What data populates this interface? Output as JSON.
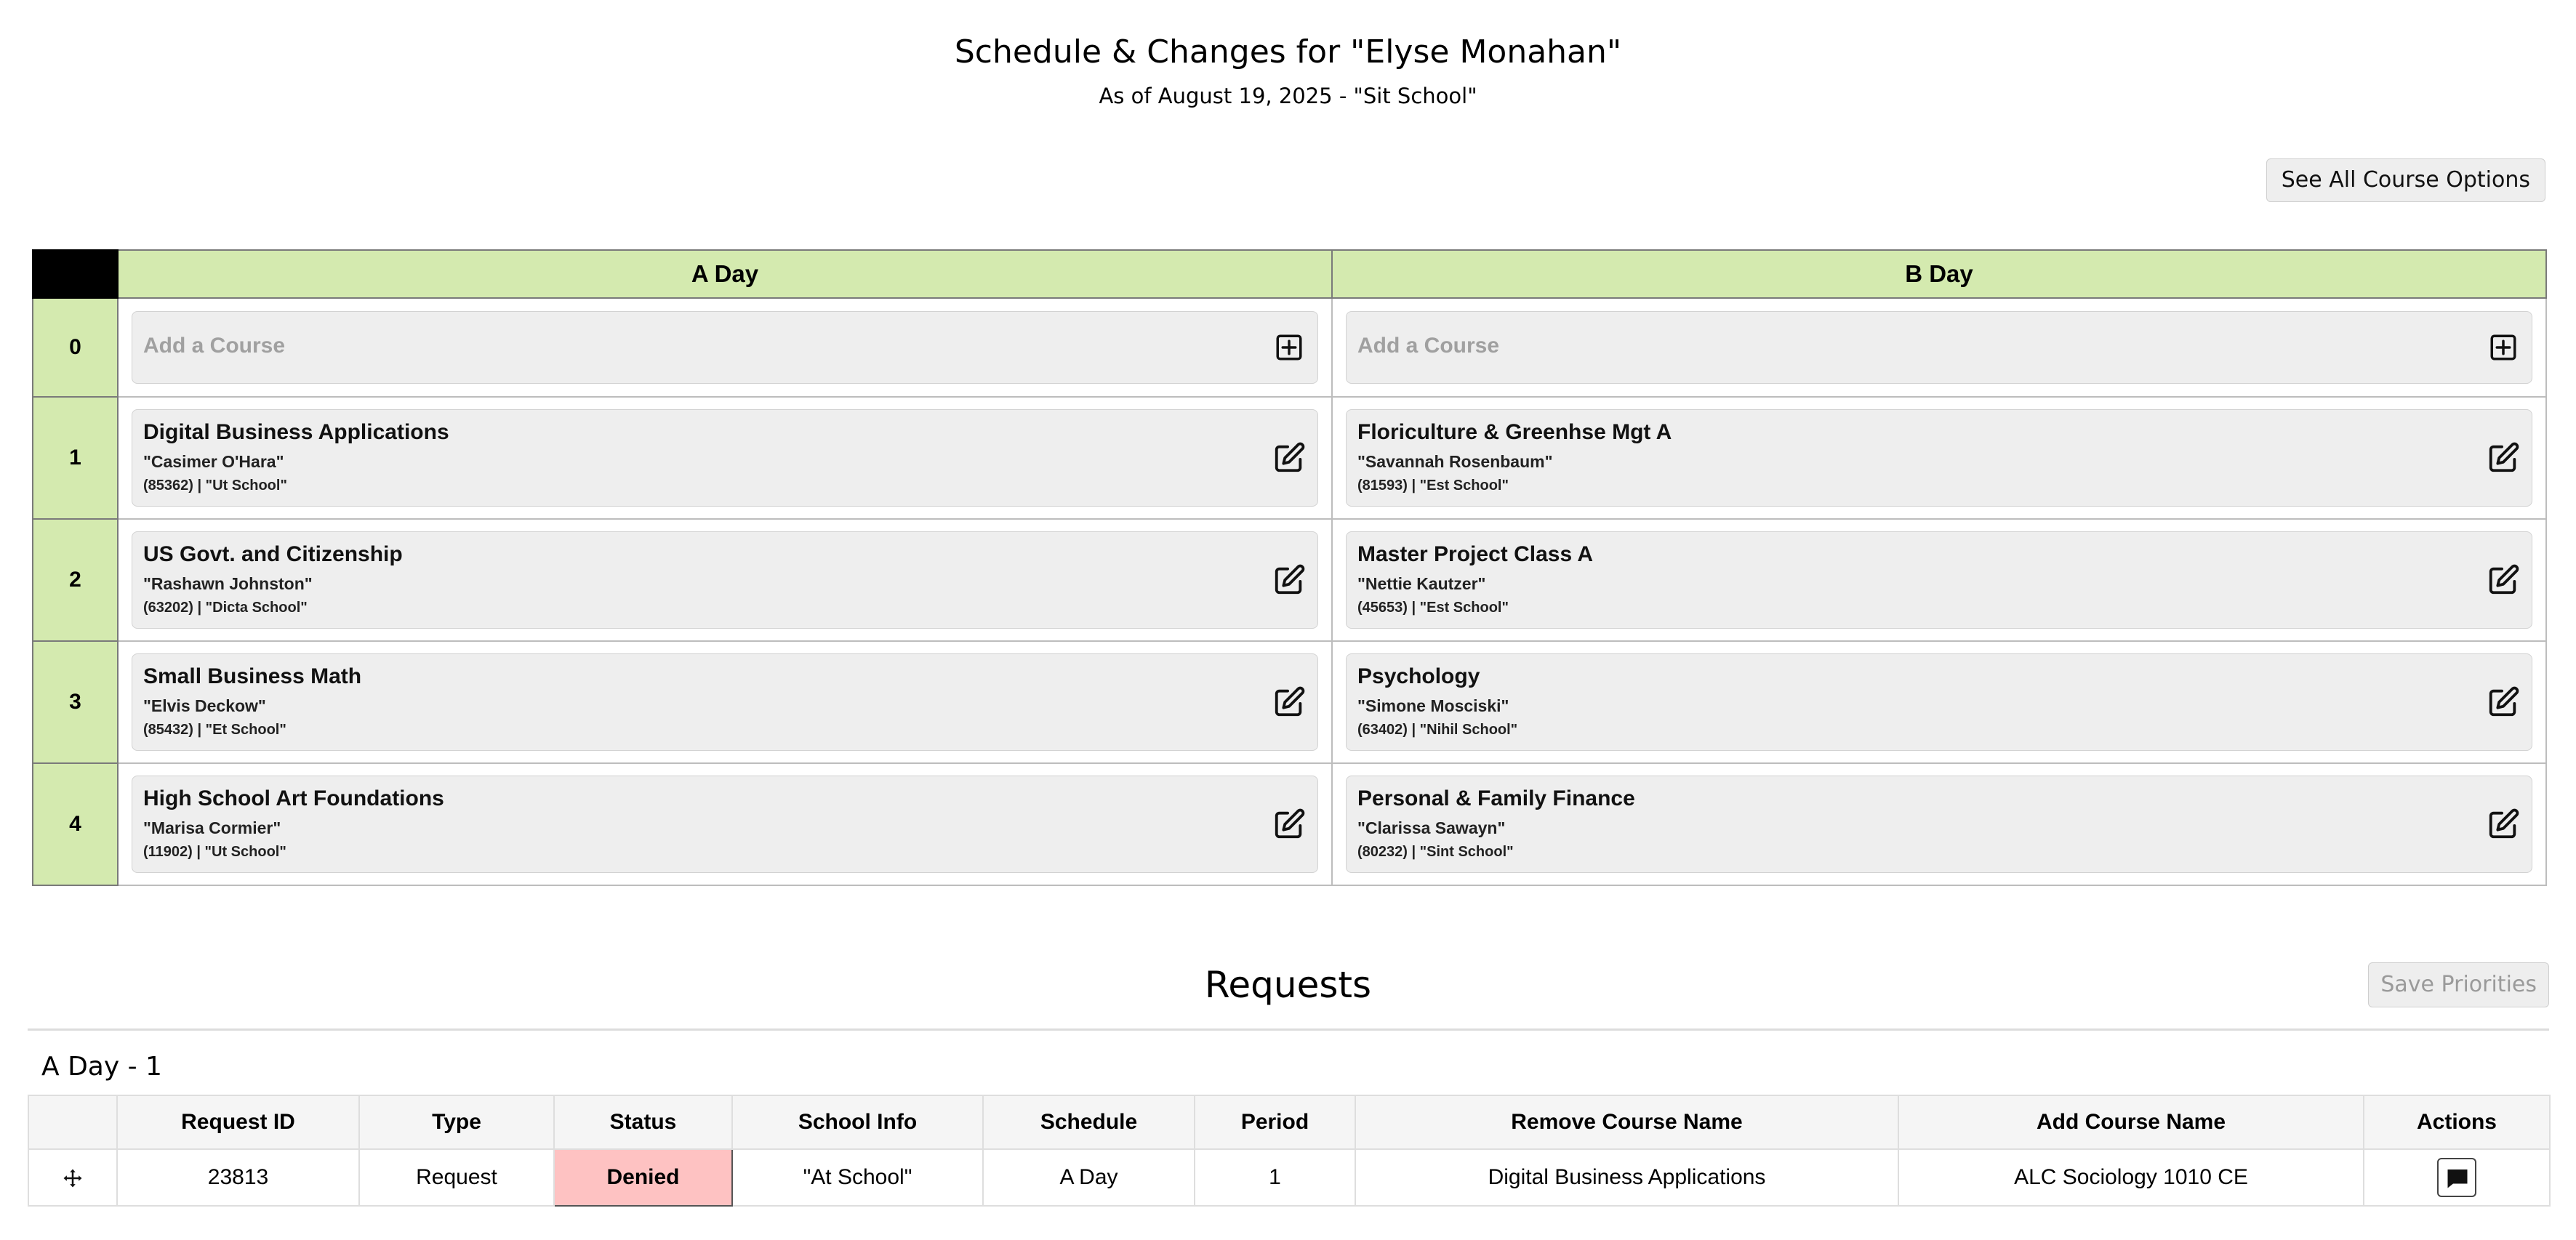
{
  "header": {
    "title": "Schedule & Changes for \"Elyse Monahan\"",
    "subtitle": "As of August 19, 2025  -  \"Sit School\""
  },
  "toolbar": {
    "see_all_label": "See All Course Options"
  },
  "schedule": {
    "days": [
      "A Day",
      "B Day"
    ],
    "rows": [
      {
        "period": "0",
        "a": {
          "type": "add",
          "label": "Add a Course"
        },
        "b": {
          "type": "add",
          "label": "Add a Course"
        }
      },
      {
        "period": "1",
        "a": {
          "type": "course",
          "name": "Digital Business Applications",
          "teacher": "\"Casimer O'Hara\"",
          "meta": "(85362) | \"Ut School\""
        },
        "b": {
          "type": "course",
          "name": "Floriculture & Greenhse Mgt A",
          "teacher": "\"Savannah Rosenbaum\"",
          "meta": "(81593) | \"Est School\""
        }
      },
      {
        "period": "2",
        "a": {
          "type": "course",
          "name": "US Govt. and Citizenship",
          "teacher": "\"Rashawn Johnston\"",
          "meta": "(63202) | \"Dicta School\""
        },
        "b": {
          "type": "course",
          "name": "Master Project Class A",
          "teacher": "\"Nettie Kautzer\"",
          "meta": "(45653) | \"Est School\""
        }
      },
      {
        "period": "3",
        "a": {
          "type": "course",
          "name": "Small Business Math",
          "teacher": "\"Elvis Deckow\"",
          "meta": "(85432) | \"Et School\""
        },
        "b": {
          "type": "course",
          "name": "Psychology",
          "teacher": "\"Simone Mosciski\"",
          "meta": "(63402) | \"Nihil School\""
        }
      },
      {
        "period": "4",
        "a": {
          "type": "course",
          "name": "High School Art Foundations",
          "teacher": "\"Marisa Cormier\"",
          "meta": "(11902) | \"Ut School\""
        },
        "b": {
          "type": "course",
          "name": "Personal & Family Finance",
          "teacher": "\"Clarissa Sawayn\"",
          "meta": "(80232) | \"Sint School\""
        }
      }
    ]
  },
  "requests": {
    "title": "Requests",
    "save_label": "Save Priorities",
    "group_label": "A Day - 1",
    "columns": [
      "",
      "Request ID",
      "Type",
      "Status",
      "School Info",
      "Schedule",
      "Period",
      "Remove Course Name",
      "Add Course Name",
      "Actions"
    ],
    "rows": [
      {
        "id": "23813",
        "type": "Request",
        "status": "Denied",
        "school": "\"At School\"",
        "schedule": "A Day",
        "period": "1",
        "remove": "Digital Business Applications",
        "add": "ALC Sociology 1010 CE"
      }
    ]
  },
  "colors": {
    "period_bg": "#d4eaaf",
    "denied_bg": "#fec2c2",
    "card_bg": "#eeeeee"
  },
  "icons": {
    "add": "plus-square-icon",
    "edit": "edit-icon",
    "move": "move-icon",
    "comment": "comment-icon"
  }
}
